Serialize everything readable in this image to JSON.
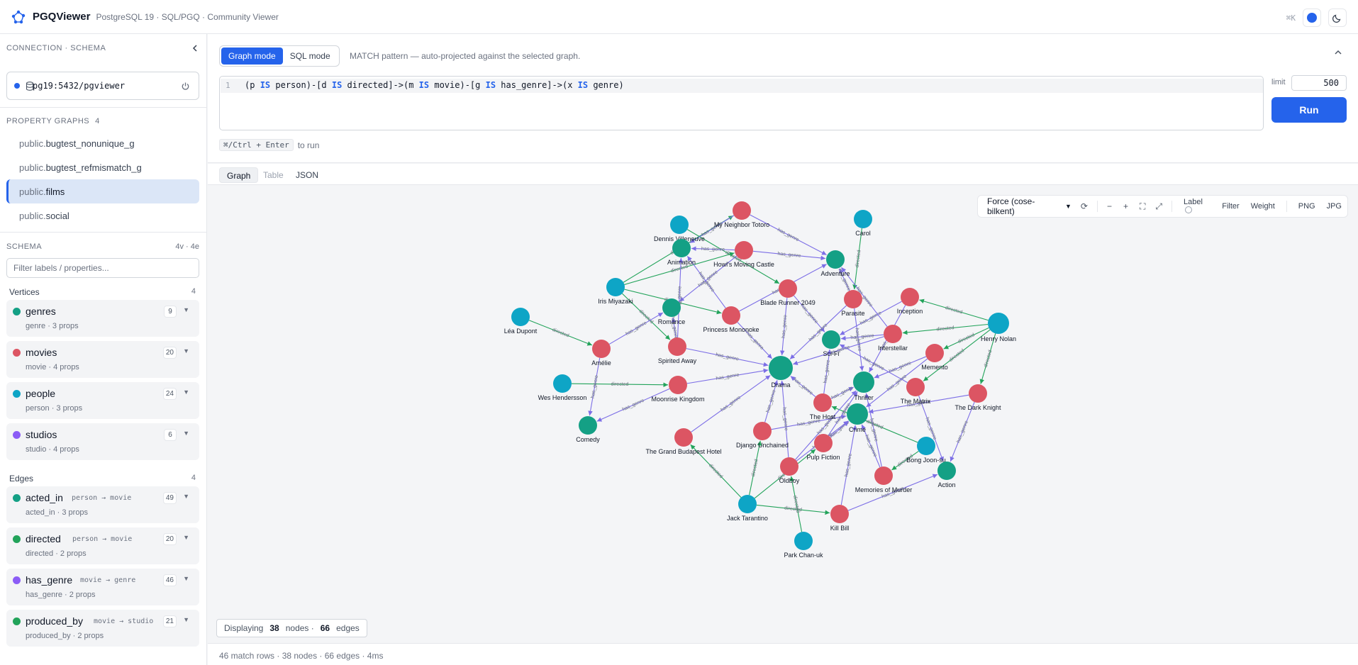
{
  "app": {
    "title": "PGQViewer",
    "subtitle": "PostgreSQL 19 · SQL/PGQ · Community Viewer",
    "shortcut": "⌘K"
  },
  "colors": {
    "accent": "#2563eb",
    "person": "#0ea5c6",
    "movie": "#dc5563",
    "genre": "#14a085",
    "studio": "#8b5cf6",
    "directed_edge": "#22a35a",
    "has_genre_edge": "#7c6ee6"
  },
  "sidebar": {
    "connection_title": "Connection · Schema",
    "connection": "pg19:5432/pgviewer",
    "graphs_title": "Property graphs",
    "graphs_count": "4",
    "graphs": [
      {
        "schema": "public.",
        "name": "bugtest_nonunique_g"
      },
      {
        "schema": "public.",
        "name": "bugtest_refmismatch_g"
      },
      {
        "schema": "public.",
        "name": "films"
      },
      {
        "schema": "public.",
        "name": "social"
      }
    ],
    "schema_title": "Schema",
    "schema_count": "4v · 4e",
    "filter_placeholder": "Filter labels / properties...",
    "vertices_title": "Vertices",
    "vertices_count": "4",
    "vertices": [
      {
        "name": "genres",
        "meta": "genre · 3 props",
        "count": "9",
        "color": "#14a085"
      },
      {
        "name": "movies",
        "meta": "movie · 4 props",
        "count": "20",
        "color": "#dc5563"
      },
      {
        "name": "people",
        "meta": "person · 3 props",
        "count": "24",
        "color": "#0ea5c6"
      },
      {
        "name": "studios",
        "meta": "studio · 4 props",
        "count": "6",
        "color": "#8b5cf6"
      }
    ],
    "edges_title": "Edges",
    "edges_count": "4",
    "edges": [
      {
        "name": "acted_in",
        "endpoints": "person → movie",
        "meta": "acted_in · 3 props",
        "count": "49",
        "color": "#14a085"
      },
      {
        "name": "directed",
        "endpoints": "person → movie",
        "meta": "directed · 2 props",
        "count": "20",
        "color": "#22a35a"
      },
      {
        "name": "has_genre",
        "endpoints": "movie → genre",
        "meta": "has_genre · 2 props",
        "count": "46",
        "color": "#8b5cf6"
      },
      {
        "name": "produced_by",
        "endpoints": "movie → studio",
        "meta": "produced_by · 2 props",
        "count": "21",
        "color": "#22a35a"
      }
    ]
  },
  "query": {
    "modes": [
      "Graph mode",
      "SQL mode"
    ],
    "mode_hint": "MATCH pattern — auto-projected against the selected graph.",
    "line_no": "1",
    "tokens": [
      {
        "t": "(p ",
        "kw": false
      },
      {
        "t": "IS",
        "kw": true
      },
      {
        "t": " person)-[d ",
        "kw": false
      },
      {
        "t": "IS",
        "kw": true
      },
      {
        "t": " directed]->(m ",
        "kw": false
      },
      {
        "t": "IS",
        "kw": true
      },
      {
        "t": " movie)-[g ",
        "kw": false
      },
      {
        "t": "IS",
        "kw": true
      },
      {
        "t": " has_genre]->(x ",
        "kw": false
      },
      {
        "t": "IS",
        "kw": true
      },
      {
        "t": " genre)",
        "kw": false
      }
    ],
    "limit_label": "limit",
    "limit_value": "500",
    "run_label": "Run",
    "run_shortcut": "⌘/Ctrl + Enter",
    "run_hint": "to run"
  },
  "result_tabs": [
    "Graph",
    "Table",
    "JSON"
  ],
  "toolbar": {
    "layout": "Force (cose-bilkent)",
    "label": "Label",
    "filter": "Filter",
    "weight": "Weight",
    "png": "PNG",
    "jpg": "JPG"
  },
  "graph": {
    "nodes": [
      {
        "id": "dv",
        "label": "Dennis Villeneuve",
        "type": "person"
      },
      {
        "id": "mnt",
        "label": "My Neighbor Totoro",
        "type": "movie"
      },
      {
        "id": "carol",
        "label": "Carol",
        "type": "person"
      },
      {
        "id": "anim",
        "label": "Animation",
        "type": "genre"
      },
      {
        "id": "hmc",
        "label": "Howl's Moving Castle",
        "type": "movie"
      },
      {
        "id": "adv",
        "label": "Adventure",
        "type": "genre"
      },
      {
        "id": "iris",
        "label": "Iris Miyazaki",
        "type": "person"
      },
      {
        "id": "rom",
        "label": "Romance",
        "type": "genre"
      },
      {
        "id": "br",
        "label": "Blade Runner 2049",
        "type": "movie"
      },
      {
        "id": "par",
        "label": "Parasite",
        "type": "movie"
      },
      {
        "id": "inc",
        "label": "Inception",
        "type": "movie"
      },
      {
        "id": "pm",
        "label": "Princess Mononoke",
        "type": "movie"
      },
      {
        "id": "lea",
        "label": "Léa Dupont",
        "type": "person"
      },
      {
        "id": "hn",
        "label": "Henry Nolan",
        "type": "person"
      },
      {
        "id": "inter",
        "label": "Interstellar",
        "type": "movie"
      },
      {
        "id": "scifi",
        "label": "Sci-Fi",
        "type": "genre"
      },
      {
        "id": "amelie",
        "label": "Amélie",
        "type": "movie"
      },
      {
        "id": "sa",
        "label": "Spirited Away",
        "type": "movie"
      },
      {
        "id": "mem",
        "label": "Memento",
        "type": "movie"
      },
      {
        "id": "drama",
        "label": "Drama",
        "type": "genre"
      },
      {
        "id": "thr",
        "label": "Thriller",
        "type": "genre"
      },
      {
        "id": "wes",
        "label": "Wes Hendersson",
        "type": "person"
      },
      {
        "id": "mk",
        "label": "Moonrise Kingdom",
        "type": "movie"
      },
      {
        "id": "matrix",
        "label": "The Matrix",
        "type": "movie"
      },
      {
        "id": "tdk",
        "label": "The Dark Knight",
        "type": "movie"
      },
      {
        "id": "host",
        "label": "The Host",
        "type": "movie"
      },
      {
        "id": "crime",
        "label": "Crime",
        "type": "genre"
      },
      {
        "id": "comedy",
        "label": "Comedy",
        "type": "genre"
      },
      {
        "id": "dj",
        "label": "Django Unchained",
        "type": "movie"
      },
      {
        "id": "gbh",
        "label": "The Grand Budapest Hotel",
        "type": "movie"
      },
      {
        "id": "pf",
        "label": "Pulp Fiction",
        "type": "movie"
      },
      {
        "id": "bjh",
        "label": "Bong Joon-su",
        "type": "person"
      },
      {
        "id": "action",
        "label": "Action",
        "type": "genre"
      },
      {
        "id": "old",
        "label": "Oldboy",
        "type": "movie"
      },
      {
        "id": "mom",
        "label": "Memories of Murder",
        "type": "movie"
      },
      {
        "id": "jt",
        "label": "Jack Tarantino",
        "type": "person"
      },
      {
        "id": "kb",
        "label": "Kill Bill",
        "type": "movie"
      },
      {
        "id": "pcw",
        "label": "Park Chan-uk",
        "type": "person"
      }
    ],
    "edges": [
      {
        "s": "dv",
        "t": "br",
        "l": "directed"
      },
      {
        "s": "iris",
        "t": "mnt",
        "l": "directed"
      },
      {
        "s": "iris",
        "t": "hmc",
        "l": "directed"
      },
      {
        "s": "iris",
        "t": "pm",
        "l": "directed"
      },
      {
        "s": "iris",
        "t": "sa",
        "l": "directed"
      },
      {
        "s": "carol",
        "t": "par",
        "l": "directed"
      },
      {
        "s": "lea",
        "t": "amelie",
        "l": "directed"
      },
      {
        "s": "hn",
        "t": "inc",
        "l": "directed"
      },
      {
        "s": "hn",
        "t": "inter",
        "l": "directed"
      },
      {
        "s": "hn",
        "t": "mem",
        "l": "directed"
      },
      {
        "s": "hn",
        "t": "matrix",
        "l": "directed"
      },
      {
        "s": "hn",
        "t": "tdk",
        "l": "directed"
      },
      {
        "s": "wes",
        "t": "mk",
        "l": "directed"
      },
      {
        "s": "bjh",
        "t": "host",
        "l": "directed"
      },
      {
        "s": "bjh",
        "t": "mom",
        "l": "directed"
      },
      {
        "s": "jt",
        "t": "gbh",
        "l": "directed"
      },
      {
        "s": "jt",
        "t": "dj",
        "l": "directed"
      },
      {
        "s": "jt",
        "t": "pf",
        "l": "directed"
      },
      {
        "s": "jt",
        "t": "kb",
        "l": "directed"
      },
      {
        "s": "pcw",
        "t": "old",
        "l": "directed"
      },
      {
        "s": "mnt",
        "t": "anim",
        "l": "has_genre"
      },
      {
        "s": "mnt",
        "t": "adv",
        "l": "has_genre"
      },
      {
        "s": "hmc",
        "t": "anim",
        "l": "has_genre"
      },
      {
        "s": "hmc",
        "t": "adv",
        "l": "has_genre"
      },
      {
        "s": "hmc",
        "t": "rom",
        "l": "has_genre"
      },
      {
        "s": "pm",
        "t": "anim",
        "l": "has_genre"
      },
      {
        "s": "pm",
        "t": "adv",
        "l": "has_genre"
      },
      {
        "s": "pm",
        "t": "drama",
        "l": "has_genre"
      },
      {
        "s": "sa",
        "t": "anim",
        "l": "has_genre"
      },
      {
        "s": "sa",
        "t": "rom",
        "l": "has_genre"
      },
      {
        "s": "sa",
        "t": "drama",
        "l": "has_genre"
      },
      {
        "s": "br",
        "t": "scifi",
        "l": "has_genre"
      },
      {
        "s": "br",
        "t": "drama",
        "l": "has_genre"
      },
      {
        "s": "par",
        "t": "thr",
        "l": "has_genre"
      },
      {
        "s": "par",
        "t": "drama",
        "l": "has_genre"
      },
      {
        "s": "par",
        "t": "adv",
        "l": "has_genre"
      },
      {
        "s": "inc",
        "t": "scifi",
        "l": "has_genre"
      },
      {
        "s": "inc",
        "t": "thr",
        "l": "has_genre"
      },
      {
        "s": "inter",
        "t": "scifi",
        "l": "has_genre"
      },
      {
        "s": "inter",
        "t": "drama",
        "l": "has_genre"
      },
      {
        "s": "mem",
        "t": "thr",
        "l": "has_genre"
      },
      {
        "s": "mem",
        "t": "crime",
        "l": "has_genre"
      },
      {
        "s": "matrix",
        "t": "scifi",
        "l": "has_genre"
      },
      {
        "s": "matrix",
        "t": "action",
        "l": "has_genre"
      },
      {
        "s": "tdk",
        "t": "action",
        "l": "has_genre"
      },
      {
        "s": "tdk",
        "t": "crime",
        "l": "has_genre"
      },
      {
        "s": "amelie",
        "t": "rom",
        "l": "has_genre"
      },
      {
        "s": "amelie",
        "t": "comedy",
        "l": "has_genre"
      },
      {
        "s": "mk",
        "t": "comedy",
        "l": "has_genre"
      },
      {
        "s": "mk",
        "t": "drama",
        "l": "has_genre"
      },
      {
        "s": "host",
        "t": "scifi",
        "l": "has_genre"
      },
      {
        "s": "host",
        "t": "thr",
        "l": "has_genre"
      },
      {
        "s": "host",
        "t": "drama",
        "l": "has_genre"
      },
      {
        "s": "dj",
        "t": "drama",
        "l": "has_genre"
      },
      {
        "s": "dj",
        "t": "crime",
        "l": "has_genre"
      },
      {
        "s": "gbh",
        "t": "drama",
        "l": "has_genre"
      },
      {
        "s": "pf",
        "t": "crime",
        "l": "has_genre"
      },
      {
        "s": "pf",
        "t": "thr",
        "l": "has_genre"
      },
      {
        "s": "old",
        "t": "thr",
        "l": "has_genre"
      },
      {
        "s": "old",
        "t": "drama",
        "l": "has_genre"
      },
      {
        "s": "mom",
        "t": "crime",
        "l": "has_genre"
      },
      {
        "s": "mom",
        "t": "thr",
        "l": "has_genre"
      },
      {
        "s": "kb",
        "t": "action",
        "l": "has_genre"
      },
      {
        "s": "kb",
        "t": "crime",
        "l": "has_genre"
      },
      {
        "s": "inter",
        "t": "adv",
        "l": "has_genre"
      },
      {
        "s": "old",
        "t": "crime",
        "l": "has_genre"
      }
    ]
  },
  "display": {
    "prefix": "Displaying",
    "nodes": "38",
    "nodes_label": "nodes ·",
    "edges": "66",
    "edges_label": "edges"
  },
  "status": "46 match rows · 38 nodes · 66 edges · 4ms"
}
